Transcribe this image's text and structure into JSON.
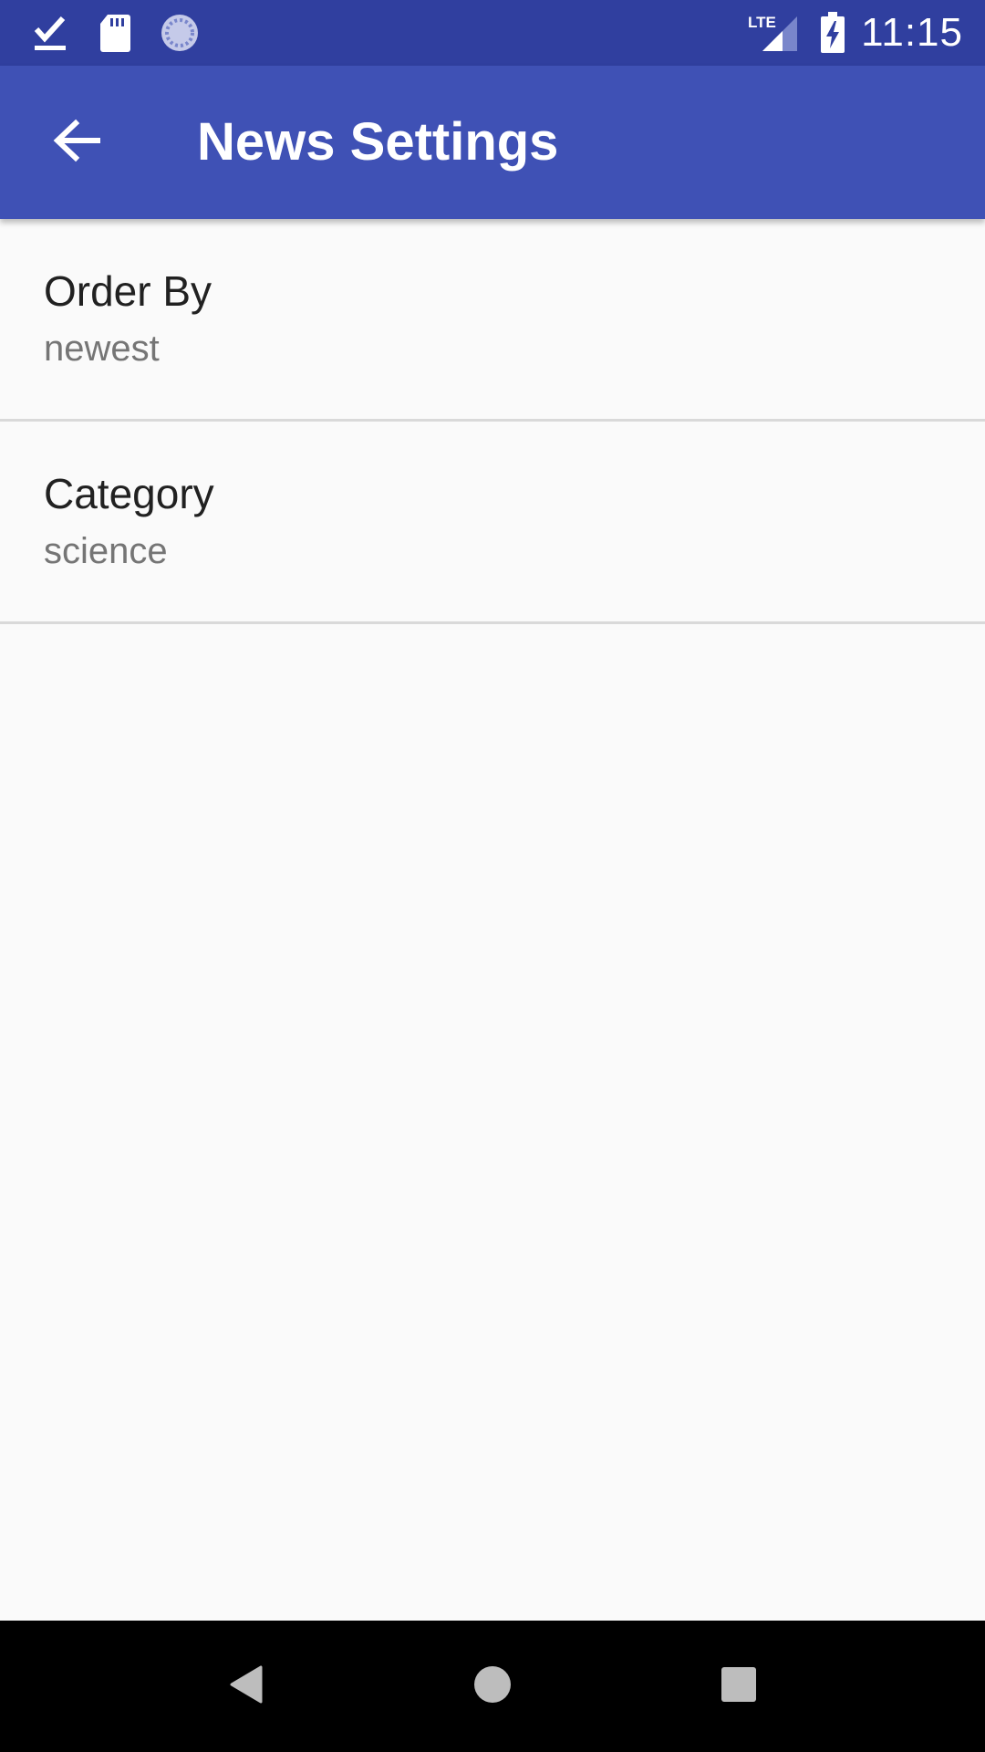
{
  "status_bar": {
    "time": "11:15",
    "network": "LTE",
    "icons": [
      "download-done-icon",
      "sd-card-icon",
      "sync-icon",
      "lte-signal-icon",
      "battery-charging-icon"
    ]
  },
  "app_bar": {
    "title": "News Settings",
    "back_icon": "arrow-back-icon",
    "color": "#3f51b5",
    "status_color": "#303f9f"
  },
  "preferences": [
    {
      "title": "Order By",
      "summary": "newest"
    },
    {
      "title": "Category",
      "summary": "science"
    }
  ],
  "nav_bar": {
    "buttons": [
      "back-triangle-icon",
      "home-circle-icon",
      "recents-square-icon"
    ]
  }
}
